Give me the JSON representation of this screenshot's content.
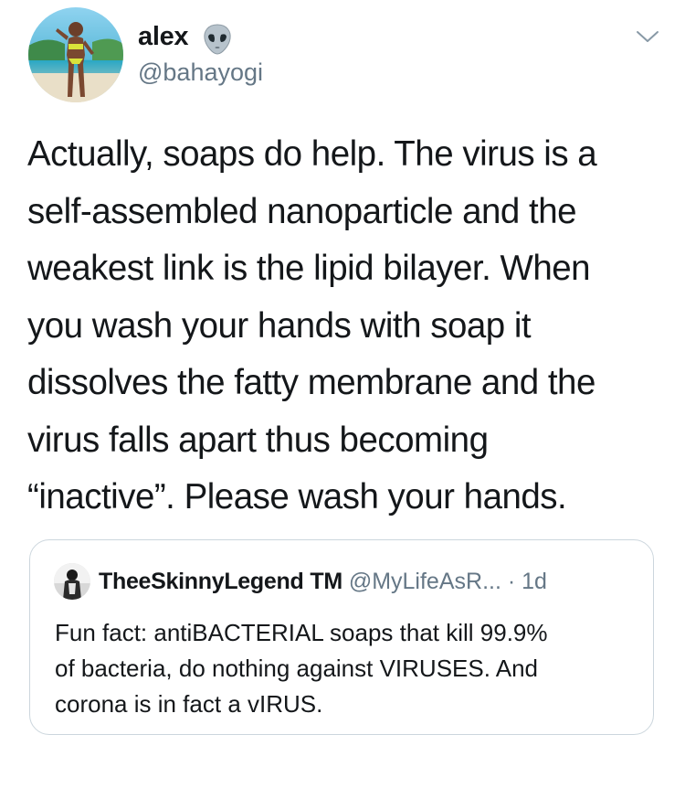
{
  "author": {
    "display_name": "alex",
    "handle": "@bahayogi",
    "name_emoji": "alien-icon"
  },
  "tweet": {
    "lines": [
      "Actually, soaps do help. The virus is a",
      "self-assembled nanoparticle and the",
      "weakest link is the lipid bilayer. When",
      "you wash your hands with soap it",
      "dissolves the fatty membrane and the",
      "virus falls apart thus becoming",
      "“inactive”. Please wash your hands."
    ]
  },
  "quoted_tweet": {
    "name": "TheeSkinnyLegend",
    "badge": "TM",
    "handle": "@MyLifeAsR...",
    "time": "· 1d",
    "lines": [
      "Fun fact: antiBACTERIAL soaps that kill 99.9%",
      "of bacteria, do nothing against VIRUSES. And",
      "corona is in fact a vIRUS."
    ]
  },
  "colors": {
    "text": "#14171a",
    "secondary": "#657786",
    "border": "#ccd6dd"
  }
}
